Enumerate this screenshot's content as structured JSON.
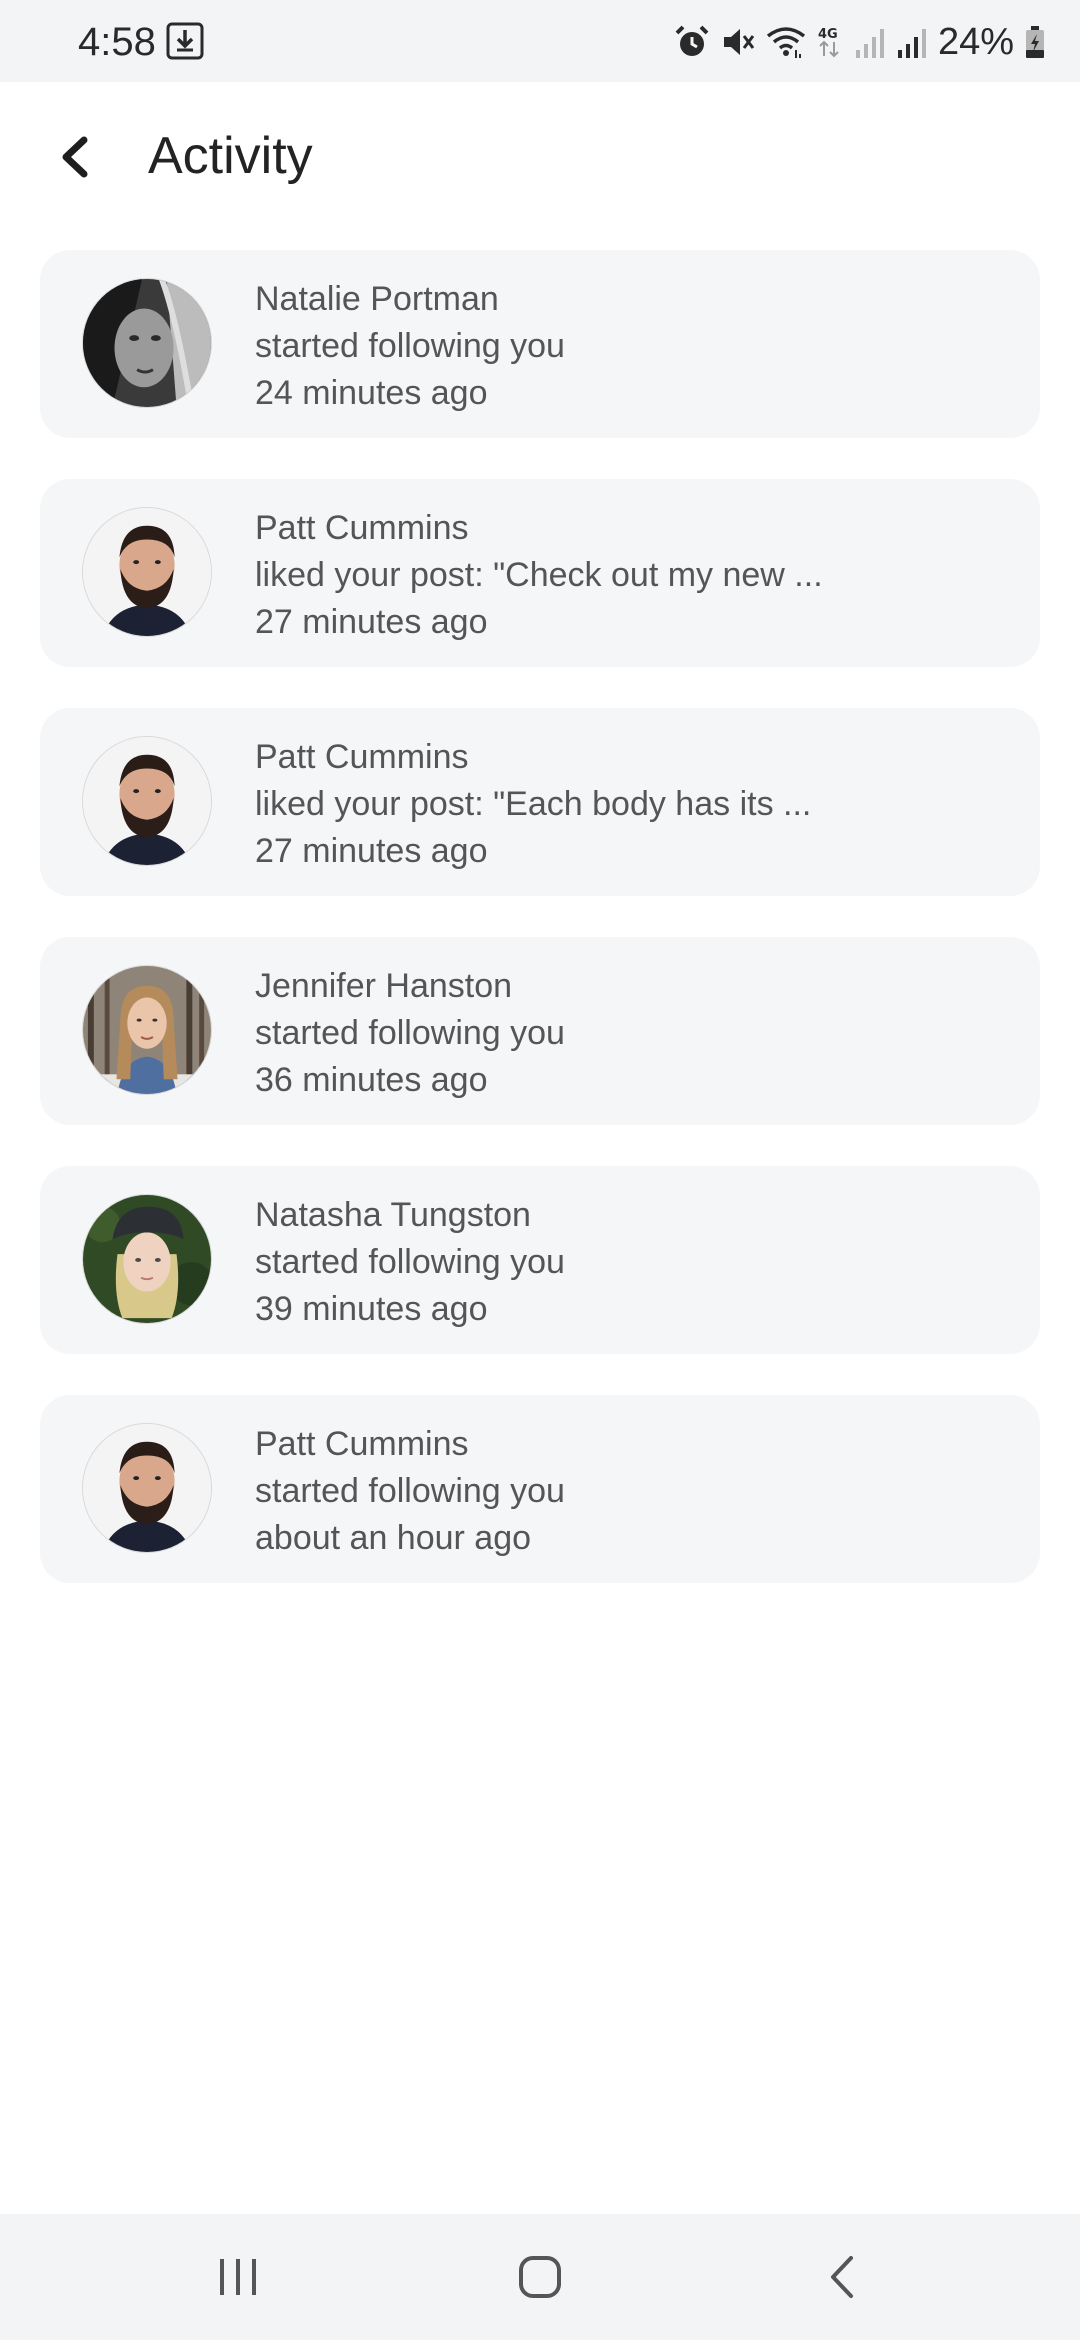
{
  "status_bar": {
    "time": "4:58",
    "battery": "24%",
    "icons": [
      "download-icon",
      "alarm-icon",
      "mute-icon",
      "wifi-icon",
      "4g-icon",
      "signal-icon",
      "signal-icon",
      "battery-icon"
    ]
  },
  "header": {
    "title": "Activity",
    "back_icon": "chevron-left-icon"
  },
  "activities": [
    {
      "name": "Natalie Portman",
      "action": "started following you",
      "time": "24 minutes ago",
      "avatar": "grayscale-portrait"
    },
    {
      "name": "Patt Cummins",
      "action": "liked your post: \"Check out my new ...",
      "time": "27 minutes ago",
      "avatar": "bearded-man-portrait"
    },
    {
      "name": "Patt Cummins",
      "action": "liked your post: \"Each body has its ...",
      "time": "27 minutes ago",
      "avatar": "bearded-man-portrait"
    },
    {
      "name": "Jennifer Hanston",
      "action": "started following you",
      "time": "36 minutes ago",
      "avatar": "long-hair-woman-portrait"
    },
    {
      "name": "Natasha Tungston",
      "action": "started following you",
      "time": "39 minutes ago",
      "avatar": "cap-woman-portrait"
    },
    {
      "name": "Patt Cummins",
      "action": "started following you",
      "time": "about an hour ago",
      "avatar": "bearded-man-portrait"
    }
  ],
  "nav_bar": {
    "icons": [
      "recents-icon",
      "home-icon",
      "back-icon"
    ]
  },
  "colors": {
    "card_background": "#f5f6f8",
    "bar_background": "#f3f4f6",
    "text_primary": "#232323",
    "text_secondary": "#555555"
  }
}
